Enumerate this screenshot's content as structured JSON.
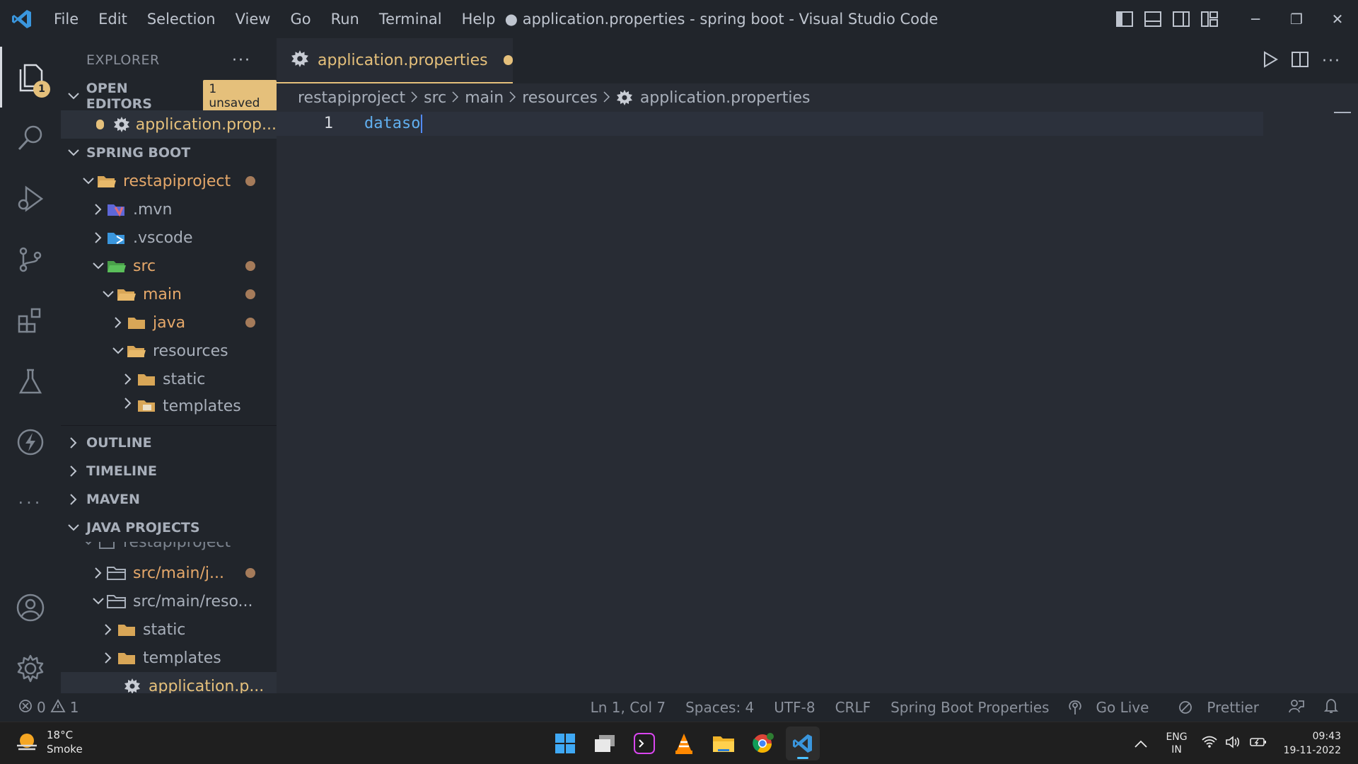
{
  "titlebar": {
    "menu": [
      "File",
      "Edit",
      "Selection",
      "View",
      "Go",
      "Run",
      "Terminal",
      "Help"
    ],
    "title": "● application.properties - spring boot - Visual Studio Code"
  },
  "activitybar": {
    "explorer_badge": "1"
  },
  "sidebar": {
    "title": "EXPLORER",
    "open_editors": {
      "label": "OPEN EDITORS",
      "badge": "1 unsaved",
      "file": "application.prop..."
    },
    "workspace": {
      "label": "SPRING BOOT"
    },
    "tree": {
      "restapiproject": "restapiproject",
      "mvn": ".mvn",
      "vscode": ".vscode",
      "src": "src",
      "main": "main",
      "java": "java",
      "resources": "resources",
      "static": "static",
      "templates": "templates"
    },
    "sections": {
      "outline": "OUTLINE",
      "timeline": "TIMELINE",
      "maven": "MAVEN",
      "java_projects": "JAVA PROJECTS"
    },
    "java_tree": {
      "project": "restapiproject",
      "src_java": "src/main/j...",
      "src_res": "src/main/reso...",
      "static": "static",
      "templates": "templates",
      "props": "application.p..."
    }
  },
  "editor": {
    "tab": "application.properties",
    "breadcrumb": [
      "restapiproject",
      "src",
      "main",
      "resources",
      "application.properties"
    ],
    "line_number": "1",
    "code": "dataso"
  },
  "statusbar": {
    "errors": "0",
    "warnings": "1",
    "position": "Ln 1, Col 7",
    "spaces": "Spaces: 4",
    "encoding": "UTF-8",
    "eol": "CRLF",
    "language": "Spring Boot Properties",
    "golive": "Go Live",
    "prettier": "Prettier"
  },
  "taskbar": {
    "temp": "18°C",
    "weather": "Smoke",
    "lang1": "ENG",
    "lang2": "IN",
    "time": "09:43",
    "date": "19-11-2022"
  },
  "colors": {
    "accent": "#e5c07b",
    "modified": "#e5a86a",
    "keyword": "#61afef",
    "background": "#282c34",
    "panel": "#21252b"
  }
}
